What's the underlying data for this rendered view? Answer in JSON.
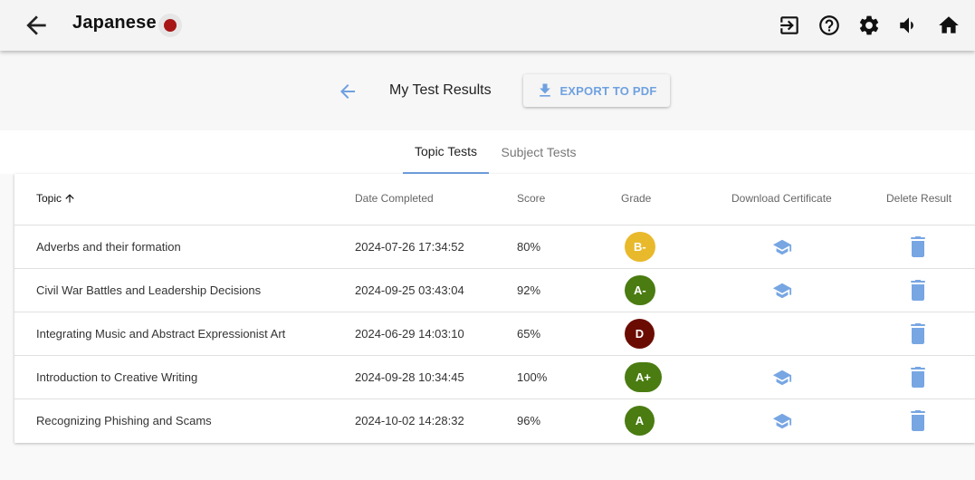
{
  "app": {
    "title": "Japanese",
    "flag": "japan-flag",
    "icons": [
      "exit-icon",
      "help-icon",
      "settings-icon",
      "volume-icon",
      "home-icon"
    ]
  },
  "header": {
    "title": "My Test Results",
    "export_label": "EXPORT TO PDF"
  },
  "tabs": [
    {
      "label": "Topic Tests",
      "active": true
    },
    {
      "label": "Subject Tests",
      "active": false
    }
  ],
  "table": {
    "columns": {
      "topic": "Topic",
      "date": "Date Completed",
      "score": "Score",
      "grade": "Grade",
      "certificate": "Download Certificate",
      "delete": "Delete Result"
    },
    "sort": {
      "column": "topic",
      "direction": "ascending"
    },
    "rows": [
      {
        "topic": "Adverbs and their formation",
        "date": "2024-07-26 17:34:52",
        "score": "80%",
        "grade": "B-",
        "grade_color": "#e9b92c",
        "certificate": true
      },
      {
        "topic": "Civil War Battles and Leadership Decisions",
        "date": "2024-09-25 03:43:04",
        "score": "92%",
        "grade": "A-",
        "grade_color": "#4a7c11",
        "certificate": true
      },
      {
        "topic": "Integrating Music and Abstract Expressionist Art",
        "date": "2024-06-29 14:03:10",
        "score": "65%",
        "grade": "D",
        "grade_color": "#6b0c02",
        "certificate": false
      },
      {
        "topic": "Introduction to Creative Writing",
        "date": "2024-09-28 10:34:45",
        "score": "100%",
        "grade": "A+",
        "grade_color": "#4a7c11",
        "certificate": true
      },
      {
        "topic": "Recognizing Phishing and Scams",
        "date": "2024-10-02 14:28:32",
        "score": "96%",
        "grade": "A",
        "grade_color": "#4a7c11",
        "certificate": true
      }
    ]
  },
  "colors": {
    "accent": "#6fa1e0",
    "icon_blue": "#77a6e3"
  }
}
